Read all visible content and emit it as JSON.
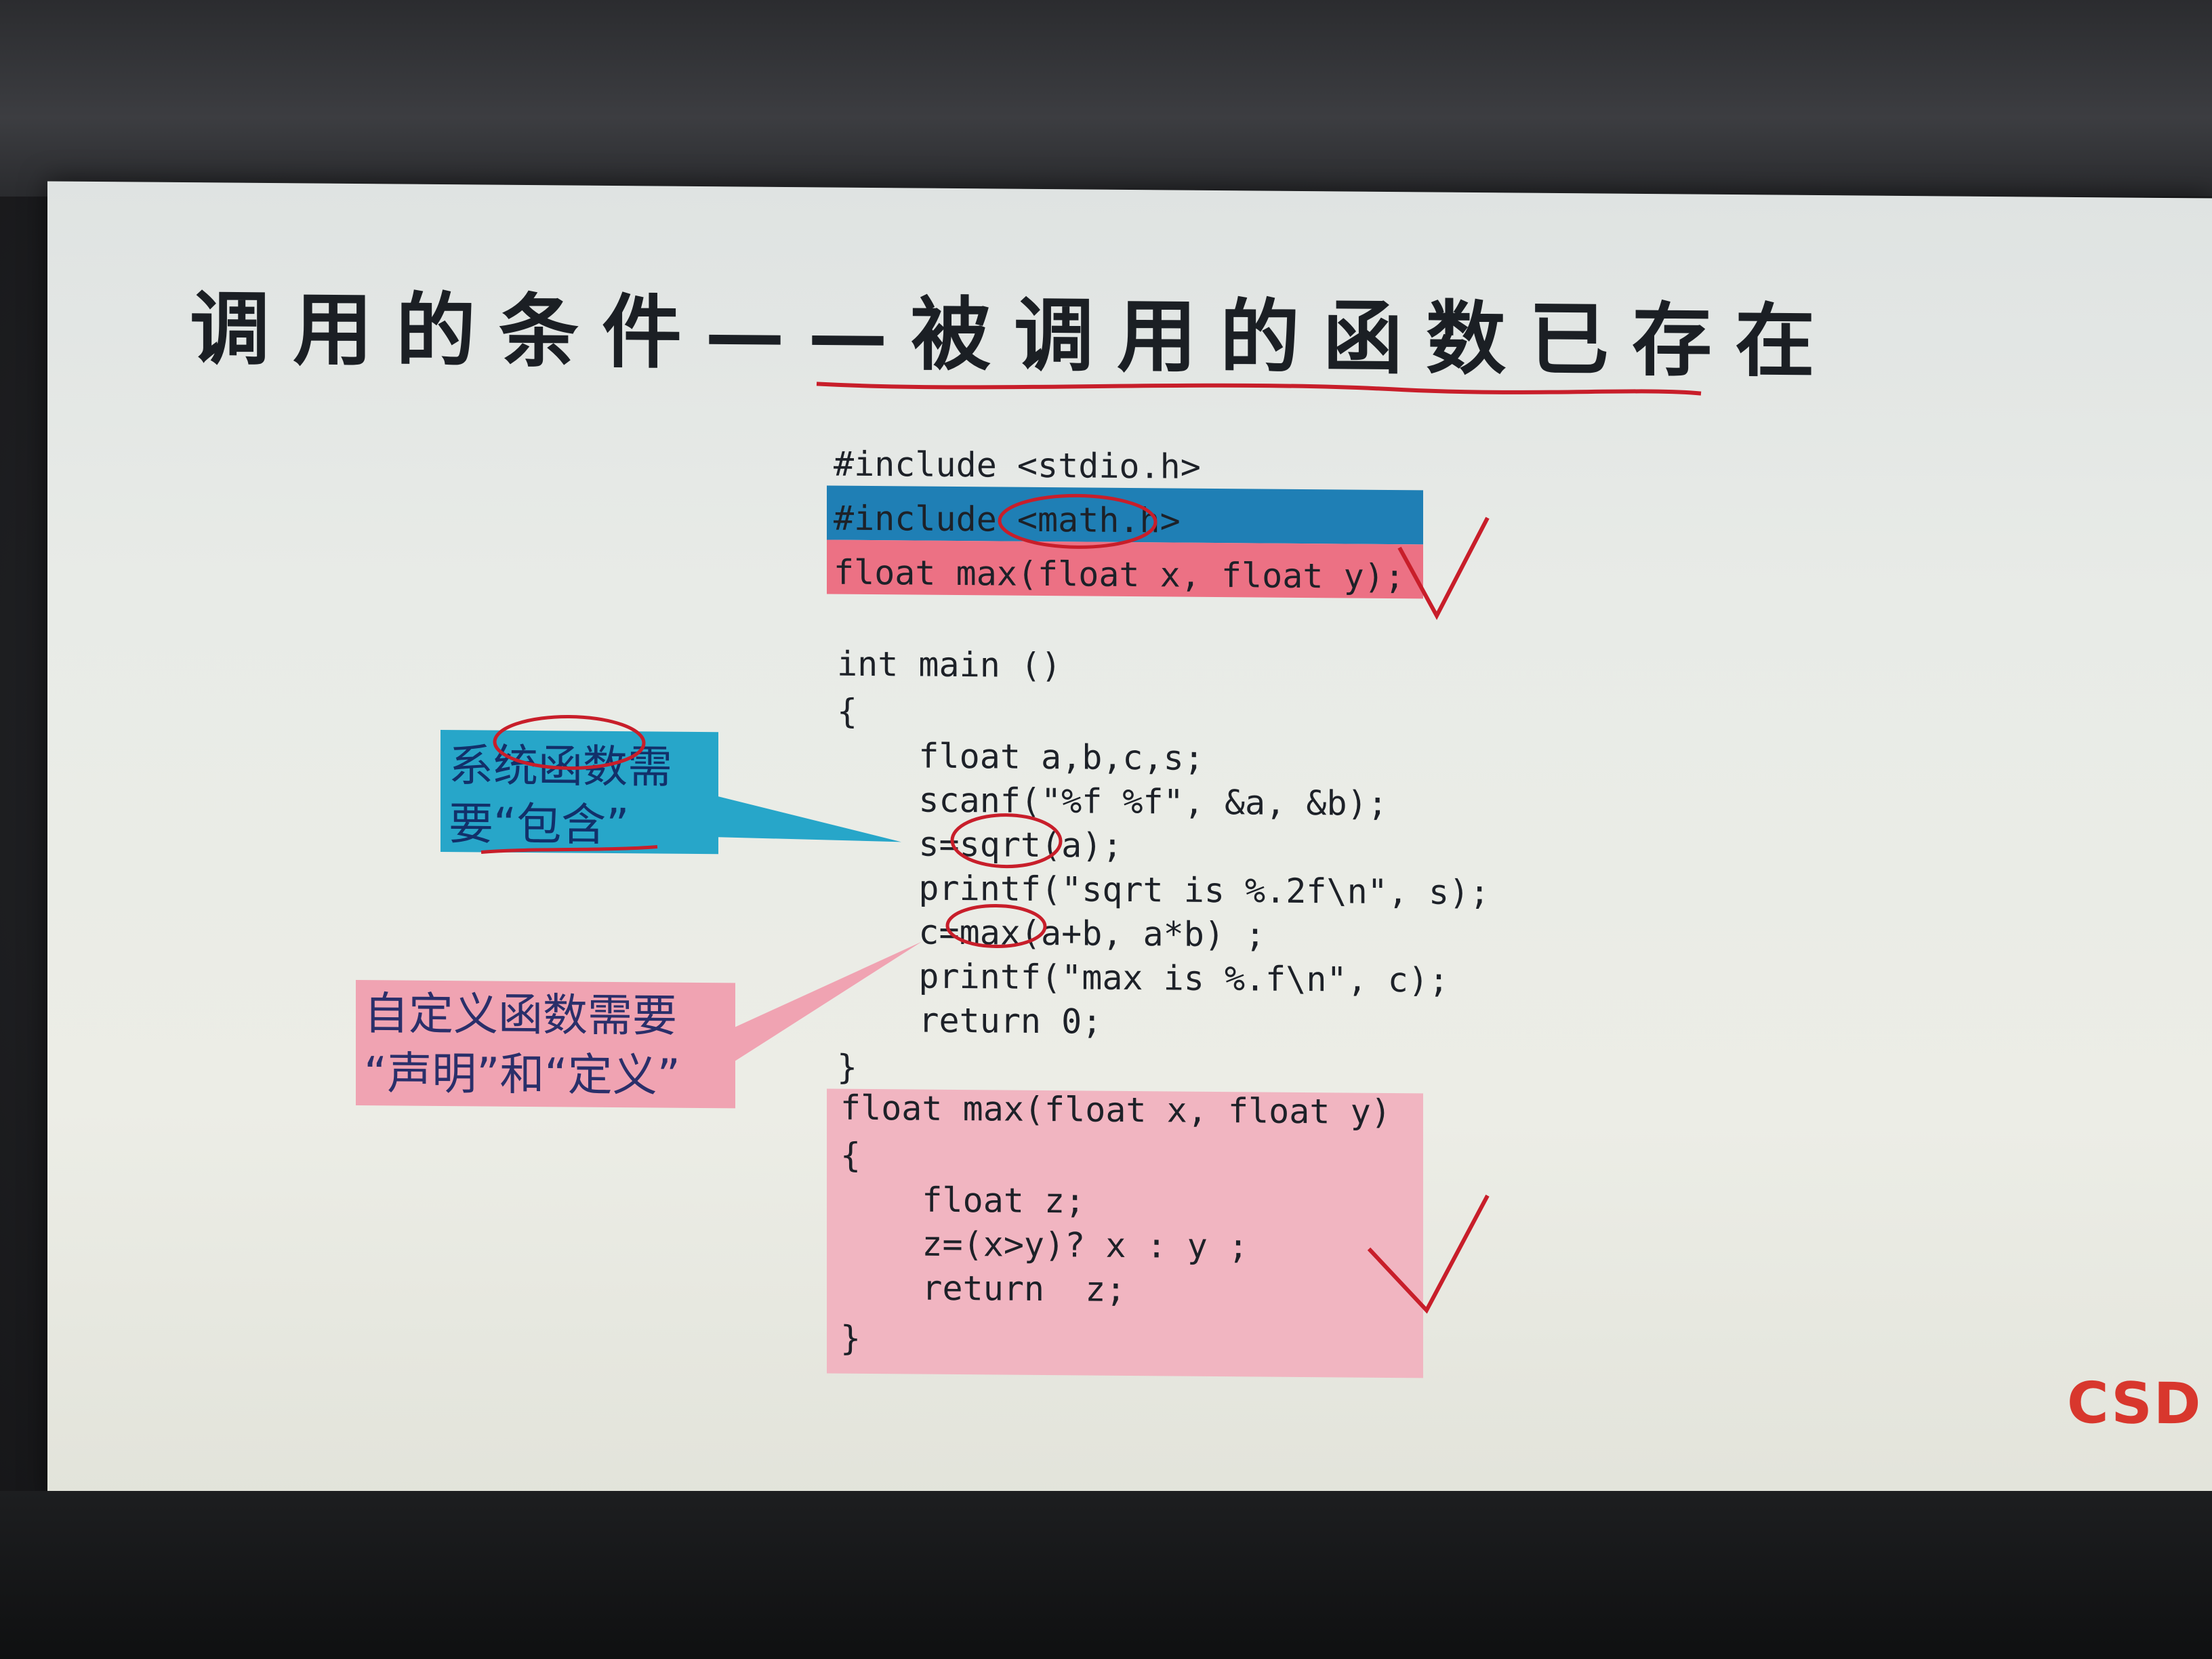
{
  "slide": {
    "title": "调用的条件——被调用的函数已存在",
    "code_lines": [
      "#include <stdio.h>",
      "#include <math.h>",
      "float max(float x, float y);",
      "",
      "int main ()",
      "{",
      "    float a,b,c,s;",
      "    scanf(\"%f %f\", &a, &b);",
      "    s=sqrt(a);",
      "    printf(\"sqrt is %.2f\\n\", s);",
      "    c=max(a+b, a*b) ;",
      "    printf(\"max is %.f\\n\", c);",
      "    return 0;",
      "}",
      "float max(float x, float y)",
      "{",
      "    float z;",
      "    z=(x>y)? x : y ;",
      "    return  z;",
      "}"
    ],
    "callout_system": {
      "line1": "系统函数需",
      "line2": "要“包含”"
    },
    "callout_custom": {
      "line1": "自定义函数需要",
      "line2": "“声明”和“定义”"
    },
    "logo": "CSD"
  },
  "colors": {
    "highlight_blue": "#1f7fb5",
    "highlight_pink": "#ec7184",
    "block_pink": "#f1b5c1",
    "callout_blue": "#27a6c9",
    "callout_pink": "#f0a3b2",
    "annotation_red": "#c81e2a"
  }
}
